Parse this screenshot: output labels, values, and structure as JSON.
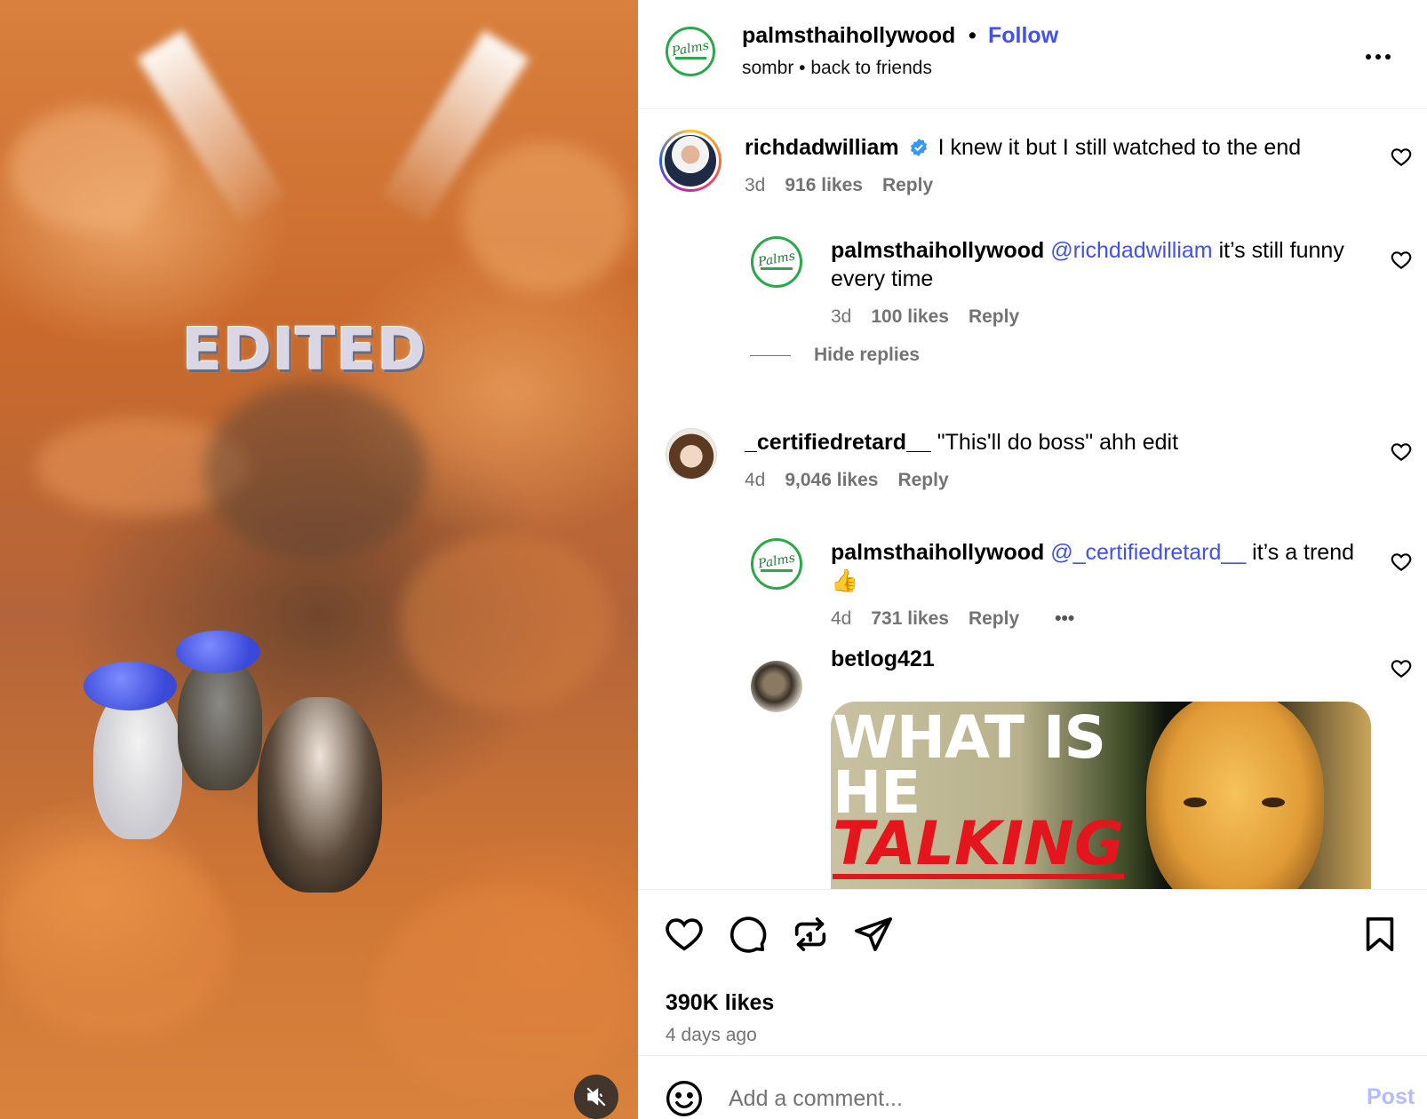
{
  "media": {
    "overlay_text": "EDITED",
    "mute_icon": "speaker-muted-icon"
  },
  "header": {
    "username": "palmsthaihollywood",
    "separator": "•",
    "follow_label": "Follow",
    "audio": "sombr • back to friends",
    "more_icon": "more-horizontal-icon",
    "avatar_text": "Palms"
  },
  "comments": [
    {
      "username": "richdadwilliam",
      "verified": true,
      "text": "I knew it but I still watched to the end",
      "age": "3d",
      "likes": "916 likes",
      "reply_label": "Reply"
    },
    {
      "username": "palmsthaihollywood",
      "mention": "@richdadwilliam",
      "text": "it’s still funny every time",
      "age": "3d",
      "likes": "100 likes",
      "reply_label": "Reply",
      "hide_replies": "Hide replies"
    },
    {
      "username": "_certifiedretard__",
      "text": "\"This'll do boss\" ahh edit",
      "age": "4d",
      "likes": "9,046 likes",
      "reply_label": "Reply"
    },
    {
      "username": "palmsthaihollywood",
      "mention": "@_certifiedretard__",
      "text": "it’s a trend 👍",
      "age": "4d",
      "likes": "731 likes",
      "reply_label": "Reply",
      "more": "•••"
    },
    {
      "username": "betlog421",
      "gif_text_1": "WHAT IS\nHE",
      "gif_text_2": "TALKING"
    }
  ],
  "actions": {
    "icons": [
      "heart-icon",
      "comment-icon",
      "repost-icon",
      "share-icon",
      "bookmark-icon"
    ],
    "likes": "390K likes",
    "posted": "4 days ago"
  },
  "add_comment": {
    "placeholder": "Add a comment...",
    "post_label": "Post"
  },
  "colors": {
    "link": "#4150f7",
    "muted": "#737373",
    "post_disabled": "#b3bdfd",
    "palms_green": "#2aa84a",
    "verified": "#3897f0"
  }
}
